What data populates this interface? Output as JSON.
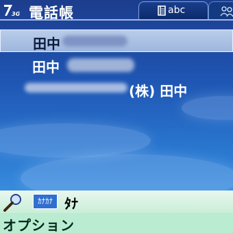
{
  "statusbar": {
    "network": "3G",
    "title": "電話帳"
  },
  "tabs": [
    {
      "label": "abc",
      "icon": "address-book-icon",
      "active": true
    },
    {
      "label": "",
      "icon": "group-icon",
      "active": false
    }
  ],
  "contacts": [
    {
      "name": "田中",
      "suffix": "",
      "selected": true
    },
    {
      "name": "田中",
      "suffix": "",
      "selected": false
    },
    {
      "name": "(株) 田中",
      "suffix": "",
      "selected": false
    }
  ],
  "search": {
    "mode_badge": "ｶﾅｶﾅ",
    "query": "ﾀﾅ"
  },
  "softkey": {
    "left_label": "オプション"
  },
  "colors": {
    "selected_row": "#b1c7e6",
    "search_bg": "#d5f2e0",
    "softkey_bg": "#b9ecd0"
  }
}
